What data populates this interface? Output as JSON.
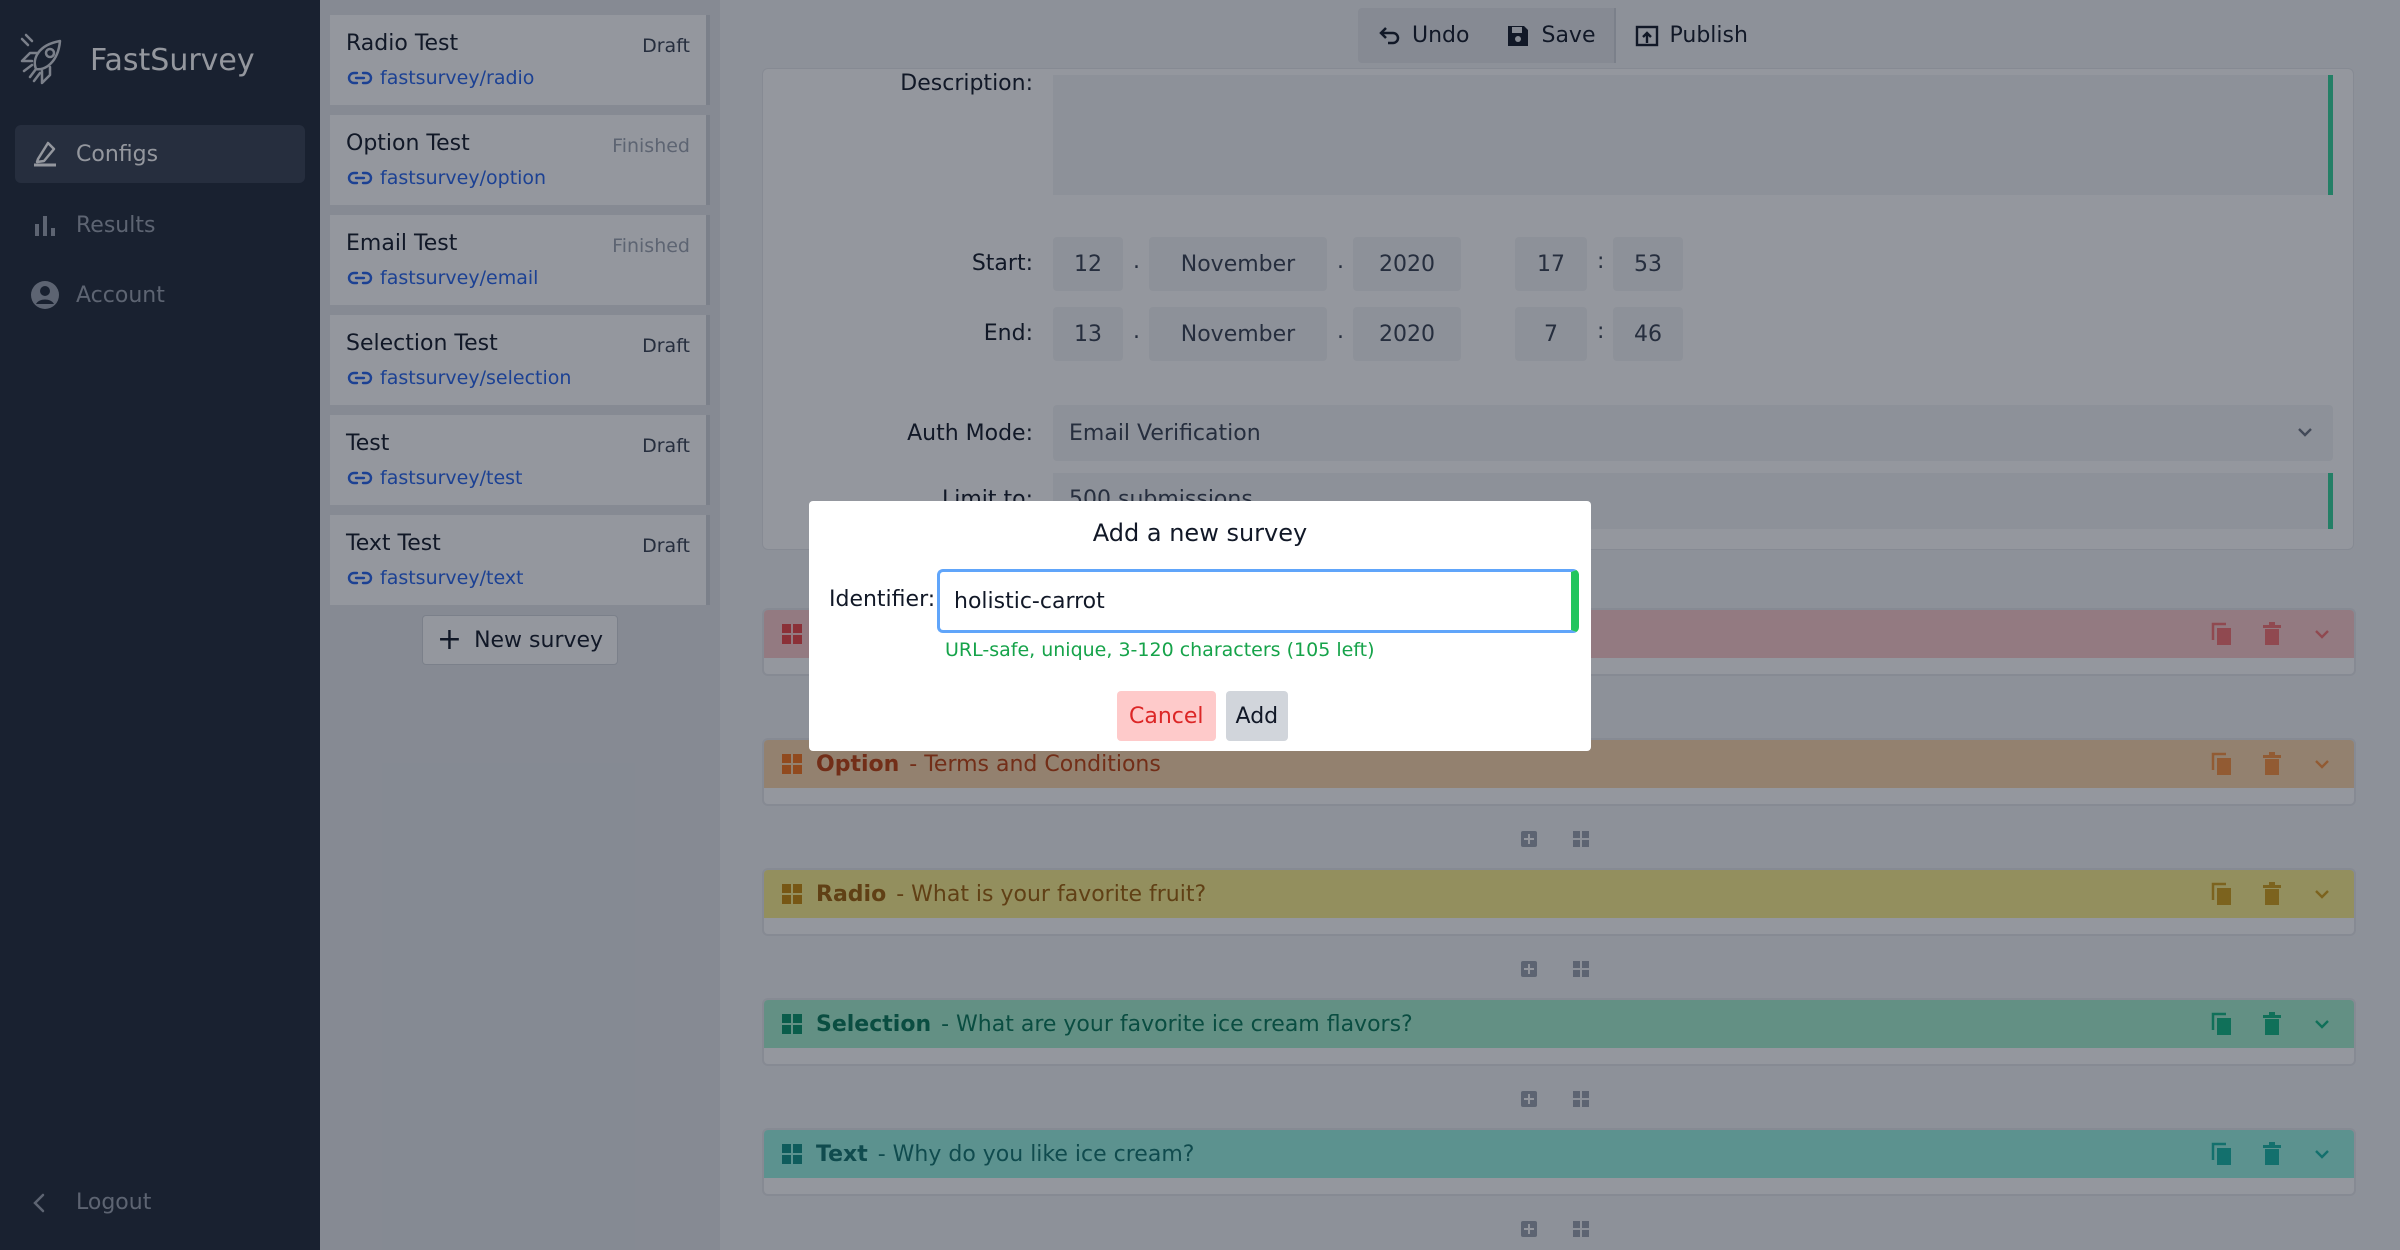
{
  "app": {
    "name": "FastSurvey"
  },
  "nav": {
    "items": [
      {
        "label": "Configs",
        "icon": "configs-icon",
        "active": true
      },
      {
        "label": "Results",
        "icon": "bar-chart-icon"
      },
      {
        "label": "Account",
        "icon": "account-icon"
      }
    ],
    "logout": "Logout"
  },
  "surveys": [
    {
      "title": "Radio Test",
      "status": "Draft",
      "link": "fastsurvey/radio"
    },
    {
      "title": "Option Test",
      "status": "Finished",
      "link": "fastsurvey/option"
    },
    {
      "title": "Email Test",
      "status": "Finished",
      "link": "fastsurvey/email"
    },
    {
      "title": "Selection Test",
      "status": "Draft",
      "link": "fastsurvey/selection"
    },
    {
      "title": "Test",
      "status": "Draft",
      "link": "fastsurvey/test"
    },
    {
      "title": "Text Test",
      "status": "Draft",
      "link": "fastsurvey/text"
    }
  ],
  "new_survey_label": "New survey",
  "toolbar": {
    "undo": "Undo",
    "save": "Save",
    "publish": "Publish"
  },
  "settings": {
    "description_label": "Description:",
    "start_label": "Start:",
    "end_label": "End:",
    "start": {
      "day": "12",
      "month": "November",
      "year": "2020",
      "hour": "17",
      "minute": "53"
    },
    "end": {
      "day": "13",
      "month": "November",
      "year": "2020",
      "hour": "7",
      "minute": "46"
    },
    "auth_label": "Auth Mode:",
    "auth_value": "Email Verification",
    "limit_label": "Limit to:",
    "limit_value": "500 submissions"
  },
  "questions": [
    {
      "type": "",
      "text": "",
      "color": "#fecaca"
    },
    {
      "type": "Option",
      "text": "- Terms and Conditions",
      "color": "#fed7aa"
    },
    {
      "type": "Radio",
      "text": "- What is your favorite fruit?",
      "color": "#fef08a"
    },
    {
      "type": "Selection",
      "text": "- What are your favorite ice cream flavors?",
      "color": "#a7f3d0"
    },
    {
      "type": "Text",
      "text": "- Why do you like ice cream?",
      "color": "#99f6e4"
    }
  ],
  "modal": {
    "title": "Add a new survey",
    "identifier_label": "Identifier:",
    "identifier_value": "holistic-carrot",
    "hint": "URL-safe, unique, 3-120 characters (105 left)",
    "cancel": "Cancel",
    "add": "Add"
  }
}
